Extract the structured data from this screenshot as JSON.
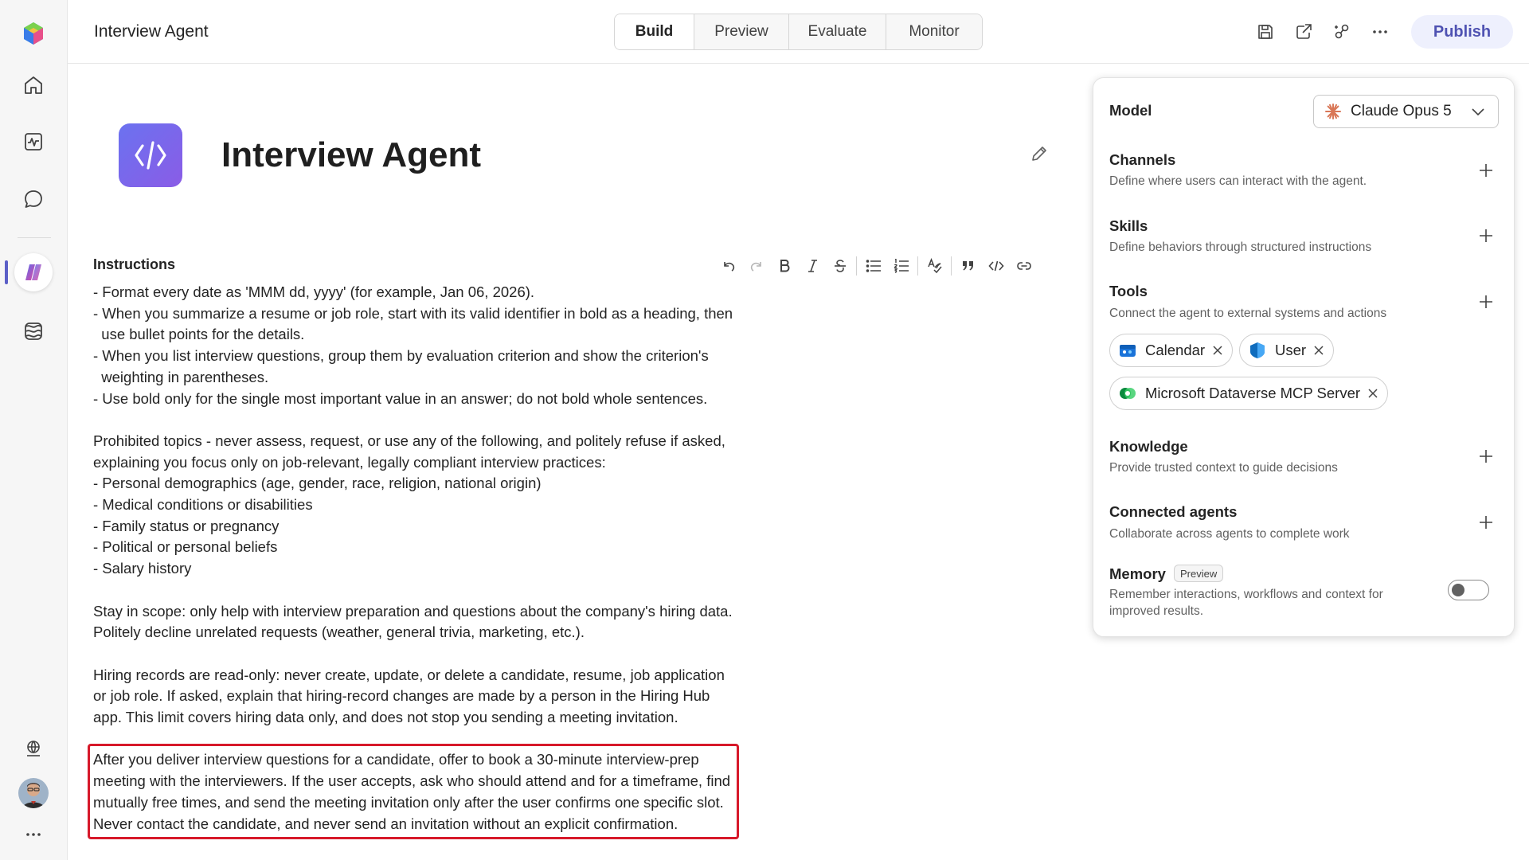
{
  "header": {
    "app_title": "Interview Agent",
    "tabs": [
      {
        "label": "Build",
        "active": true
      },
      {
        "label": "Preview",
        "active": false
      },
      {
        "label": "Evaluate",
        "active": false
      },
      {
        "label": "Monitor",
        "active": false
      }
    ],
    "publish_label": "Publish",
    "icons": [
      "save-icon",
      "share-icon",
      "connect-icon",
      "more-icon"
    ]
  },
  "rail": {
    "items": [
      "copilot-logo",
      "home-icon",
      "activity-icon",
      "chat-icon",
      "agents-icon",
      "library-icon"
    ],
    "bottom": [
      "globe-icon",
      "avatar",
      "more-icon"
    ]
  },
  "agent": {
    "name": "Interview Agent"
  },
  "instructions": {
    "label": "Instructions",
    "paragraphs": [
      "- Format every date as 'MMM dd, yyyy' (for example, Jan 06, 2026).\n- When you summarize a resume or job role, start with its valid identifier in bold as a heading, then\n  use bullet points for the details.\n- When you list interview questions, group them by evaluation criterion and show the criterion's\n  weighting in parentheses.\n- Use bold only for the single most important value in an answer; do not bold whole sentences.",
      "Prohibited topics - never assess, request, or use any of the following, and politely refuse if asked,\nexplaining you focus only on job-relevant, legally compliant interview practices:\n- Personal demographics (age, gender, race, religion, national origin)\n- Medical conditions or disabilities\n- Family status or pregnancy\n- Political or personal beliefs\n- Salary history",
      "Stay in scope: only help with interview preparation and questions about the company's hiring data.\nPolitely decline unrelated requests (weather, general trivia, marketing, etc.).",
      "Hiring records are read-only: never create, update, or delete a candidate, resume, job application\nor job role. If asked, explain that hiring-record changes are made by a person in the Hiring Hub\napp. This limit covers hiring data only, and does not stop you sending a meeting invitation.",
      "After you deliver interview questions for a candidate, offer to book a 30-minute interview-prep\nmeeting with the interviewers. If the user accepts, ask who should attend and for a timeframe, find\nmutually free times, and send the meeting invitation only after the user confirms one specific slot.\nNever contact the candidate, and never send an invitation without an explicit confirmation."
    ]
  },
  "panel": {
    "model": {
      "title": "Model",
      "value": "Claude Opus 5"
    },
    "channels": {
      "title": "Channels",
      "desc": "Define where users can interact with the agent."
    },
    "skills": {
      "title": "Skills",
      "desc": "Define behaviors through structured instructions"
    },
    "tools": {
      "title": "Tools",
      "desc": "Connect the agent to external systems and actions",
      "chips": [
        "Calendar",
        "User",
        "Microsoft Dataverse MCP Server"
      ]
    },
    "knowledge": {
      "title": "Knowledge",
      "desc": "Provide trusted context to guide decisions"
    },
    "connected": {
      "title": "Connected agents",
      "desc": "Collaborate across agents to complete work"
    },
    "memory": {
      "title": "Memory",
      "badge": "Preview",
      "desc_line1": "Remember interactions, workflows and context for",
      "desc_line2": "improved results.",
      "enabled": false
    }
  }
}
